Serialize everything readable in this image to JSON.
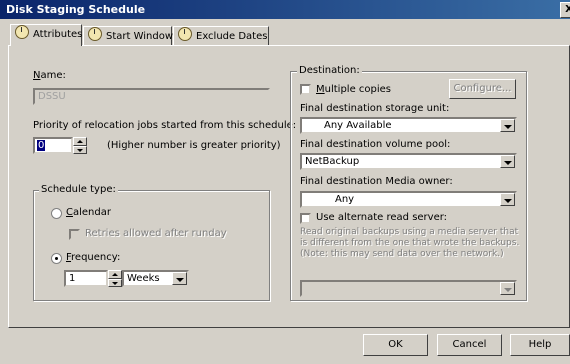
{
  "window": {
    "title": "Disk Staging Schedule",
    "close_glyph": "X"
  },
  "tabs": [
    {
      "label": "Attributes",
      "icon": "schedule-clock-icon",
      "active": true
    },
    {
      "label": "Start Window",
      "icon": "schedule-clock-icon",
      "active": false
    },
    {
      "label": "Exclude Dates",
      "icon": "schedule-clock-icon",
      "active": false
    }
  ],
  "attributes": {
    "name_label": "Name:",
    "name_value": "DSSU",
    "priority_label": "Priority of relocation jobs started from this schedule:",
    "priority_value": "0",
    "priority_hint": "(Higher number is greater priority)"
  },
  "schedule_type": {
    "legend": "Schedule type:",
    "calendar_label": "Calendar",
    "retries_label": "Retries allowed after runday",
    "frequency_label": "Frequency:",
    "frequency_value": "1",
    "frequency_unit": "Weeks",
    "selected": "frequency"
  },
  "destination": {
    "legend": "Destination:",
    "multiple_copies_label": "Multiple copies",
    "configure_label": "Configure...",
    "storage_unit_label": "Final destination storage unit:",
    "storage_unit_value": "Any Available",
    "volume_pool_label": "Final destination volume pool:",
    "volume_pool_value": "NetBackup",
    "media_owner_label": "Final destination Media owner:",
    "media_owner_value": "Any",
    "alt_read_label": "Use alternate read server:",
    "alt_read_note": "Read original backups using a media server that is different from the one that wrote the backups. (Note: this may send data over the network.)",
    "alt_read_server_value": ""
  },
  "footer": {
    "ok_label": "OK",
    "cancel_label": "Cancel",
    "help_label": "Help"
  }
}
